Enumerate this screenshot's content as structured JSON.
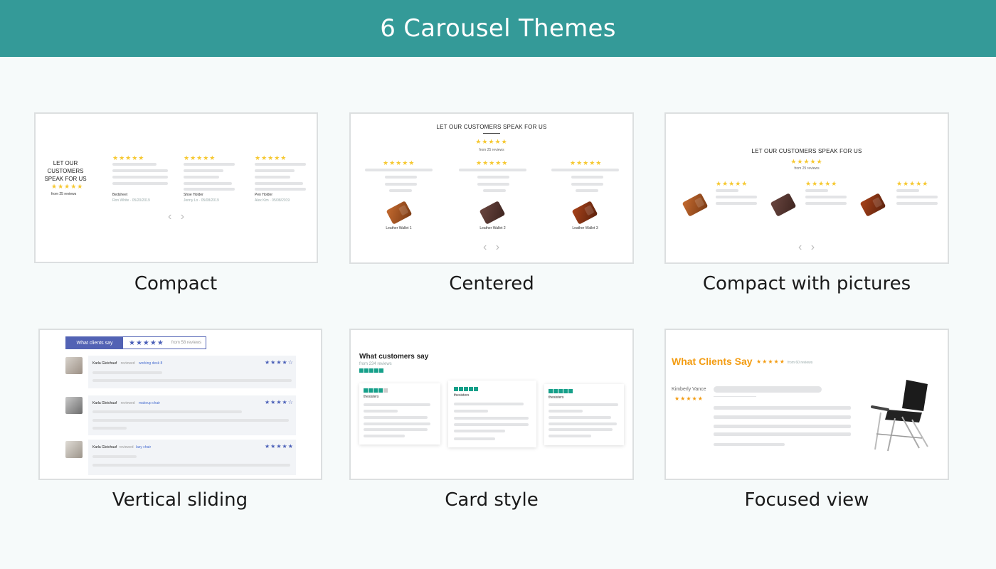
{
  "header": {
    "title": "6 Carousel Themes"
  },
  "themes": [
    {
      "caption": "Compact"
    },
    {
      "caption": "Centered"
    },
    {
      "caption": "Compact with pictures"
    },
    {
      "caption": "Vertical sliding"
    },
    {
      "caption": "Card style"
    },
    {
      "caption": "Focused view"
    }
  ],
  "compact": {
    "heading_line1": "LET OUR",
    "heading_line2": "CUSTOMERS",
    "heading_line3": "SPEAK FOR US",
    "stars": "★★★★★",
    "from": "from 25 reviews",
    "items": [
      {
        "product": "Bedsheet",
        "author": "Ron White · 05/20/2019"
      },
      {
        "product": "Shoe Holder",
        "author": "Jenny Lo · 05/08/2019"
      },
      {
        "product": "Pen Holder",
        "author": "Alex Kim · 05/08/2019"
      }
    ],
    "arrows": "‹ ›"
  },
  "centered": {
    "heading": "LET OUR CUSTOMERS SPEAK FOR US",
    "stars": "★★★★★",
    "from": "from 25 reviews",
    "products": [
      "Leather Wallet 1",
      "Leather Wallet 2",
      "Leather Wallet 3"
    ],
    "arrows": "‹ ›"
  },
  "compact_pictures": {
    "heading": "LET OUR CUSTOMERS SPEAK FOR US",
    "stars": "★★★★★",
    "from": "from 25 reviews",
    "arrows": "‹ ›"
  },
  "vertical": {
    "tab_label": "What clients say",
    "tab_stars": "★★★★★",
    "tab_from": "from 58 reviews",
    "reviews": [
      {
        "name": "Karla Gleichauf",
        "verb": "reviewed",
        "product": "working desk 8",
        "stars": "★★★★☆"
      },
      {
        "name": "Karla Gleichauf",
        "verb": "reviewed",
        "product": "makeup chair",
        "stars": "★★★★☆"
      },
      {
        "name": "Karla Gleichauf",
        "verb": "reviewed",
        "product": "lazy chair",
        "stars": "★★★★★"
      }
    ]
  },
  "card_style": {
    "title": "What customers say",
    "from": "from 234 reviews",
    "cards": [
      {
        "author": "thesisters"
      },
      {
        "author": "thesisters"
      },
      {
        "author": "thesisters"
      }
    ]
  },
  "focused": {
    "title": "What Clients Say",
    "stars": "★★★★★",
    "from": "from 60 reviews",
    "reviewer": "Kimberly Vance",
    "reviewer_stars": "★★★★★"
  },
  "colors": {
    "header_bg": "#349a98",
    "star_yellow": "#f6c830",
    "star_blue": "#4a5fb8",
    "trustpilot_green": "#16a08a",
    "focused_orange": "#f39c12"
  }
}
